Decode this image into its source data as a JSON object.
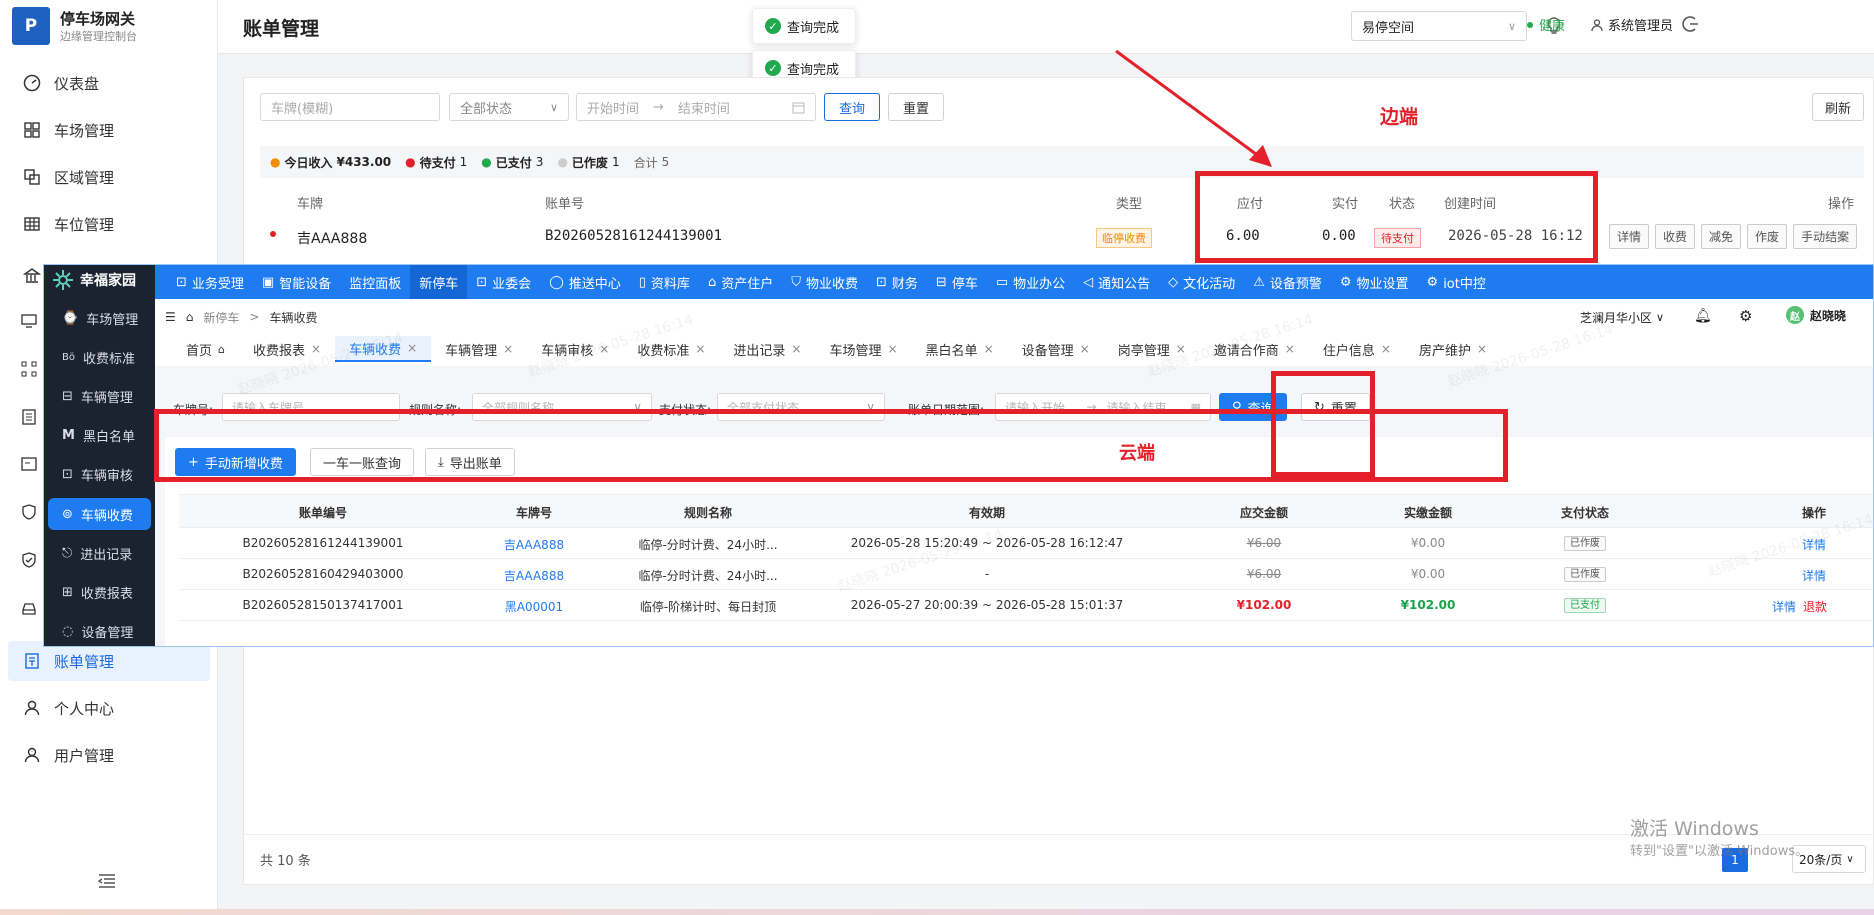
{
  "back": {
    "app_title": "停车场网关",
    "app_subtitle": "边缘管理控制台",
    "logo_letter": "P",
    "page_title": "账单管理",
    "toasts": [
      "查询完成",
      "查询完成"
    ],
    "header": {
      "space": "易停空间",
      "user": "系统管理员",
      "health": "健康"
    },
    "nav": [
      "仪表盘",
      "车场管理",
      "区域管理",
      "车位管理",
      "账单管理",
      "个人中心",
      "用户管理"
    ],
    "filters": {
      "plate_placeholder": "车牌(模糊)",
      "status": "全部状态",
      "start": "开始时间",
      "arrow": "→",
      "end": "结束时间",
      "query": "查询",
      "reset": "重置",
      "refresh": "刷新"
    },
    "summary": {
      "today_income_label": "今日收入",
      "today_income": "¥433.00",
      "pending_label": "待支付",
      "pending": "1",
      "paid_label": "已支付",
      "paid": "3",
      "voided_label": "已作废",
      "voided": "1",
      "total_label": "合计",
      "total": "5"
    },
    "columns": [
      "车牌",
      "账单号",
      "类型",
      "应付",
      "实付",
      "状态",
      "创建时间",
      "操作"
    ],
    "row": {
      "plate": "吉AAA888",
      "bill_no": "B20260528161244139001",
      "type": "临停收费",
      "due": "6.00",
      "paid": "0.00",
      "status": "待支付",
      "created": "2026-05-28 16:12",
      "actions": [
        "详情",
        "收费",
        "减免",
        "作废",
        "手动结案"
      ]
    },
    "pagination": {
      "total": "共 10 条",
      "page": "1",
      "size": "20条/页"
    },
    "edge_label": "边端",
    "windows_watermark": "激活 Windows",
    "windows_watermark_sub": "转到\"设置\"以激活 Windows。"
  },
  "cloud": {
    "brand": "幸福家园",
    "top_nav": [
      "业务受理",
      "智能设备",
      "监控面板",
      "新停车",
      "业委会",
      "推送中心",
      "资料库",
      "资产住户",
      "物业收费",
      "财务",
      "停车",
      "物业办公",
      "通知公告",
      "文化活动",
      "设备预警",
      "物业设置",
      "iot中控"
    ],
    "side_menu": [
      "车场管理",
      "收费标准",
      "车辆管理",
      "黑白名单",
      "车辆审核",
      "车辆收费",
      "进出记录",
      "收费报表",
      "设备管理"
    ],
    "breadcrumb": [
      "新停车",
      "车辆收费"
    ],
    "community": "芝澜月华小区",
    "user": "赵晓晓",
    "tabs": [
      "首页",
      "收费报表",
      "车辆收费",
      "车辆管理",
      "车辆审核",
      "收费标准",
      "进出记录",
      "车场管理",
      "黑白名单",
      "设备管理",
      "岗亭管理",
      "邀请合作商",
      "住户信息",
      "房产维护"
    ],
    "filters": {
      "plate_label": "车牌号:",
      "plate_ph": "请输入车牌号",
      "rule_label": "规则名称:",
      "rule_ph": "全部规则名称",
      "pay_label": "支付状态:",
      "pay_ph": "全部支付状态",
      "date_label": "账单日期范围:",
      "date_start": "请输入开始...",
      "date_arrow": "→",
      "date_end": "请输入结束...",
      "query": "查询",
      "reset": "重置"
    },
    "actions": {
      "add": "手动新增收费",
      "one_car": "一车一账查询",
      "export": "导出账单"
    },
    "cloud_label": "云端",
    "columns": [
      "账单编号",
      "车牌号",
      "规则名称",
      "有效期",
      "应交金额",
      "实缴金额",
      "支付状态",
      "操作"
    ],
    "rows": [
      {
        "bill": "B20260528161244139001",
        "plate": "吉AAA888",
        "rule": "临停-分时计费、24小时...",
        "valid": "2026-05-28 15:20:49 ~ 2026-05-28 16:12:47",
        "due": "¥6.00",
        "paid": "¥0.00",
        "status": "已作废",
        "ops": [
          "详情"
        ]
      },
      {
        "bill": "B20260528160429403000",
        "plate": "吉AAA888",
        "rule": "临停-分时计费、24小时...",
        "valid": "-",
        "due": "¥6.00",
        "paid": "¥0.00",
        "status": "已作废",
        "ops": [
          "详情"
        ]
      },
      {
        "bill": "B20260528150137417001",
        "plate": "黑A00001",
        "rule": "临停-阶梯计时、每日封顶",
        "valid": "2026-05-27 20:00:39 ~ 2026-05-28 15:01:37",
        "due": "¥102.00",
        "paid": "¥102.00",
        "status": "已支付",
        "ops": [
          "详情",
          "退款"
        ]
      }
    ],
    "watermark": "赵晓晓 2026-05-28 16:14"
  }
}
